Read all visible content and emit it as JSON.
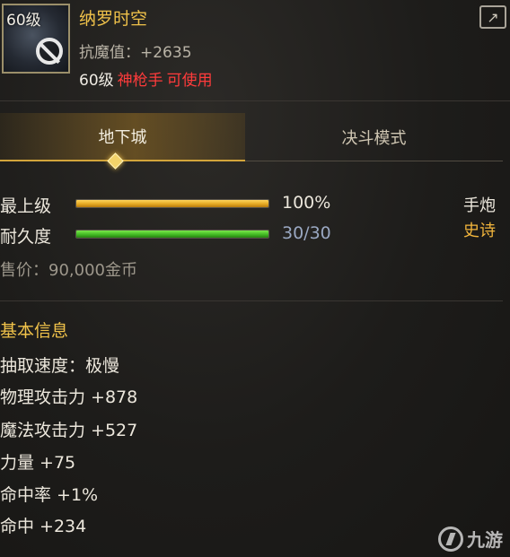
{
  "item": {
    "level_badge": "60级",
    "name": "纳罗时空",
    "anti_magic": "抗魔值：+2635",
    "req_level": "60级",
    "req_class": "神枪手",
    "req_usable": "可使用"
  },
  "tabs": [
    {
      "label": "地下城",
      "active": true
    },
    {
      "label": "决斗模式",
      "active": false
    }
  ],
  "bars": {
    "upgrade": {
      "label": "最上级",
      "value_text": "100%",
      "fill": 1.0,
      "color": "#e1a41f"
    },
    "durability": {
      "label": "耐久度",
      "value_text": "30/30",
      "fill": 1.0,
      "color": "#3fb521"
    }
  },
  "weapon_type": "手炮",
  "rarity": "史诗",
  "rarity_color": "#f2b53c",
  "price": "售价：90,000金币",
  "basic_info": {
    "title": "基本信息",
    "stats": [
      "抽取速度：极慢",
      "物理攻击力 +878",
      "魔法攻击力 +527",
      "力量 +75",
      "命中率 +1%",
      "命中 +234"
    ]
  },
  "watermark": "九游",
  "icons": {
    "share": "share-icon",
    "ban": "ban-icon",
    "tab_indicator": "diamond-icon"
  }
}
